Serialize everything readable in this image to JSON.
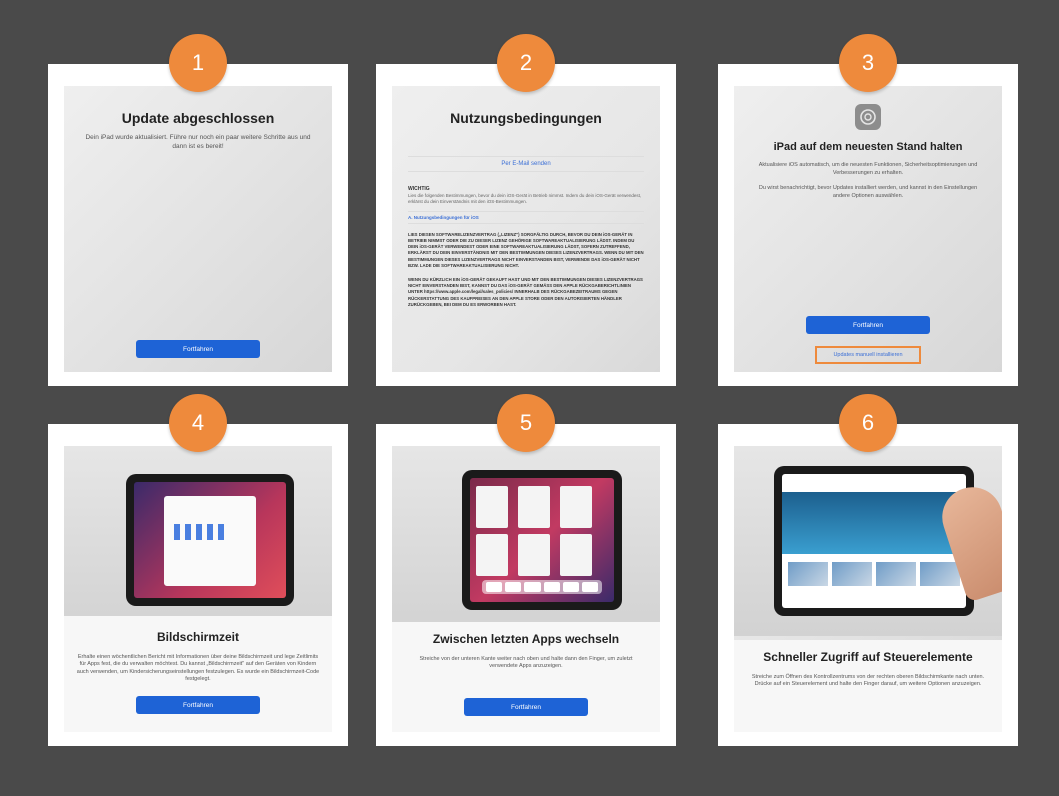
{
  "steps": [
    {
      "number": "1",
      "title": "Update abgeschlossen",
      "text": "Dein iPad wurde aktualisiert. Führe nur noch ein paar weitere Schritte aus und dann ist es bereit!",
      "button": "Fortfahren"
    },
    {
      "number": "2",
      "title": "Nutzungsbedingungen",
      "email_link": "Per E-Mail senden",
      "important_head": "WICHTIG",
      "important_text": "Lies die folgenden Bestimmungen, bevor du dein iOS-Gerät in Betrieb nimmst. Indem du dein iOS-Gerät verwendest, erklärst du dein Einverständnis mit den iOS-Bestimmungen.",
      "ios_link": "A. Nutzungsbedingungen für iOS",
      "legal_1": "LIES DIESEN SOFTWARELIZENZVERTRAG („LIZENZ\") SORGFÄLTIG DURCH, BEVOR DU DEIN iOS-GERÄT IN BETRIEB NIMMST ODER DIE ZU DIESER LIZENZ GEHÖRIGE SOFTWAREAKTUALISIERUNG LÄDST. INDEM DU DEIN iOS-GERÄT VERWENDEST ODER EINE SOFTWAREAKTUALISIERUNG LÄDST, SOFERN ZUTREFFEND, ERKLÄRST DU DEIN EINVERSTÄNDNIS MIT DEN BESTIMMUNGEN DIESES LIZENZVERTRAGS. WENN DU MIT DEN BESTIMMUNGEN DIESES LIZENZVERTRAGS NICHT EINVERSTANDEN BIST, VERWENDE DAS iOS-GERÄT NICHT BZW. LADE DIE SOFTWAREAKTUALISIERUNG NICHT.",
      "legal_2": "WENN DU KÜRZLICH EIN iOS-GERÄT GEKAUFT HAST UND MIT DEN BESTIMMUNGEN DIESES LIZENZVERTRAGS NICHT EINVERSTANDEN BIST, KANNST DU DAS iOS-GERÄT GEMÄSS DEN APPLE RÜCKGABERICHTLINIEN UNTER https://www.apple.com/legal/sales_policies/ INNERHALB DES RÜCKGABEZEITRAUMS GEGEN RÜCKERSTATTUNG DES KAUFPREISES AN DEN APPLE STORE ODER DEN AUTORISIERTEN HÄNDLER ZURÜCKGEBEN, BEI DEM DU ES ERWORBEN HAST."
    },
    {
      "number": "3",
      "title": "iPad auf dem neuesten Stand halten",
      "text_1": "Aktualisiere iOS automatisch, um die neuesten Funktionen, Sicherheitsoptimierungen und Verbesserungen zu erhalten.",
      "text_2": "Du wirst benachrichtigt, bevor Updates installiert werden, und kannst in den Einstellungen andere Optionen auswählen.",
      "button": "Fortfahren",
      "manual_link": "Updates manuell installieren"
    },
    {
      "number": "4",
      "title": "Bildschirmzeit",
      "text": "Erhalte einen wöchentlichen Bericht mit Informationen über deine Bildschirmzeit und lege Zeitlimits für Apps fest, die du verwalten möchtest. Du kannst „Bildschirmzeit\" auf den Geräten von Kindern auch verwenden, um Kindersicherungseinstellungen festzulegen. Es wurde ein Bildschirmzeit-Code festgelegt.",
      "button": "Fortfahren"
    },
    {
      "number": "5",
      "title": "Zwischen letzten Apps wechseln",
      "text": "Streiche von der unteren Kante weiter nach oben und halte dann den Finger, um zuletzt verwendete Apps anzuzeigen.",
      "button": "Fortfahren"
    },
    {
      "number": "6",
      "title": "Schneller Zugriff auf Steuerelemente",
      "text": "Streiche zum Öffnen des Kontrollzentrums von der rechten oberen Bildschirmkante nach unten. Drücke auf ein Steuerelement und halte den Finger darauf, um weitere Optionen anzuzeigen."
    }
  ],
  "colors": {
    "background": "#4a4a4a",
    "badge": "#ee8a3c",
    "button": "#1e63d6",
    "link": "#3b6fd6",
    "highlight": "#ee8a3c"
  }
}
